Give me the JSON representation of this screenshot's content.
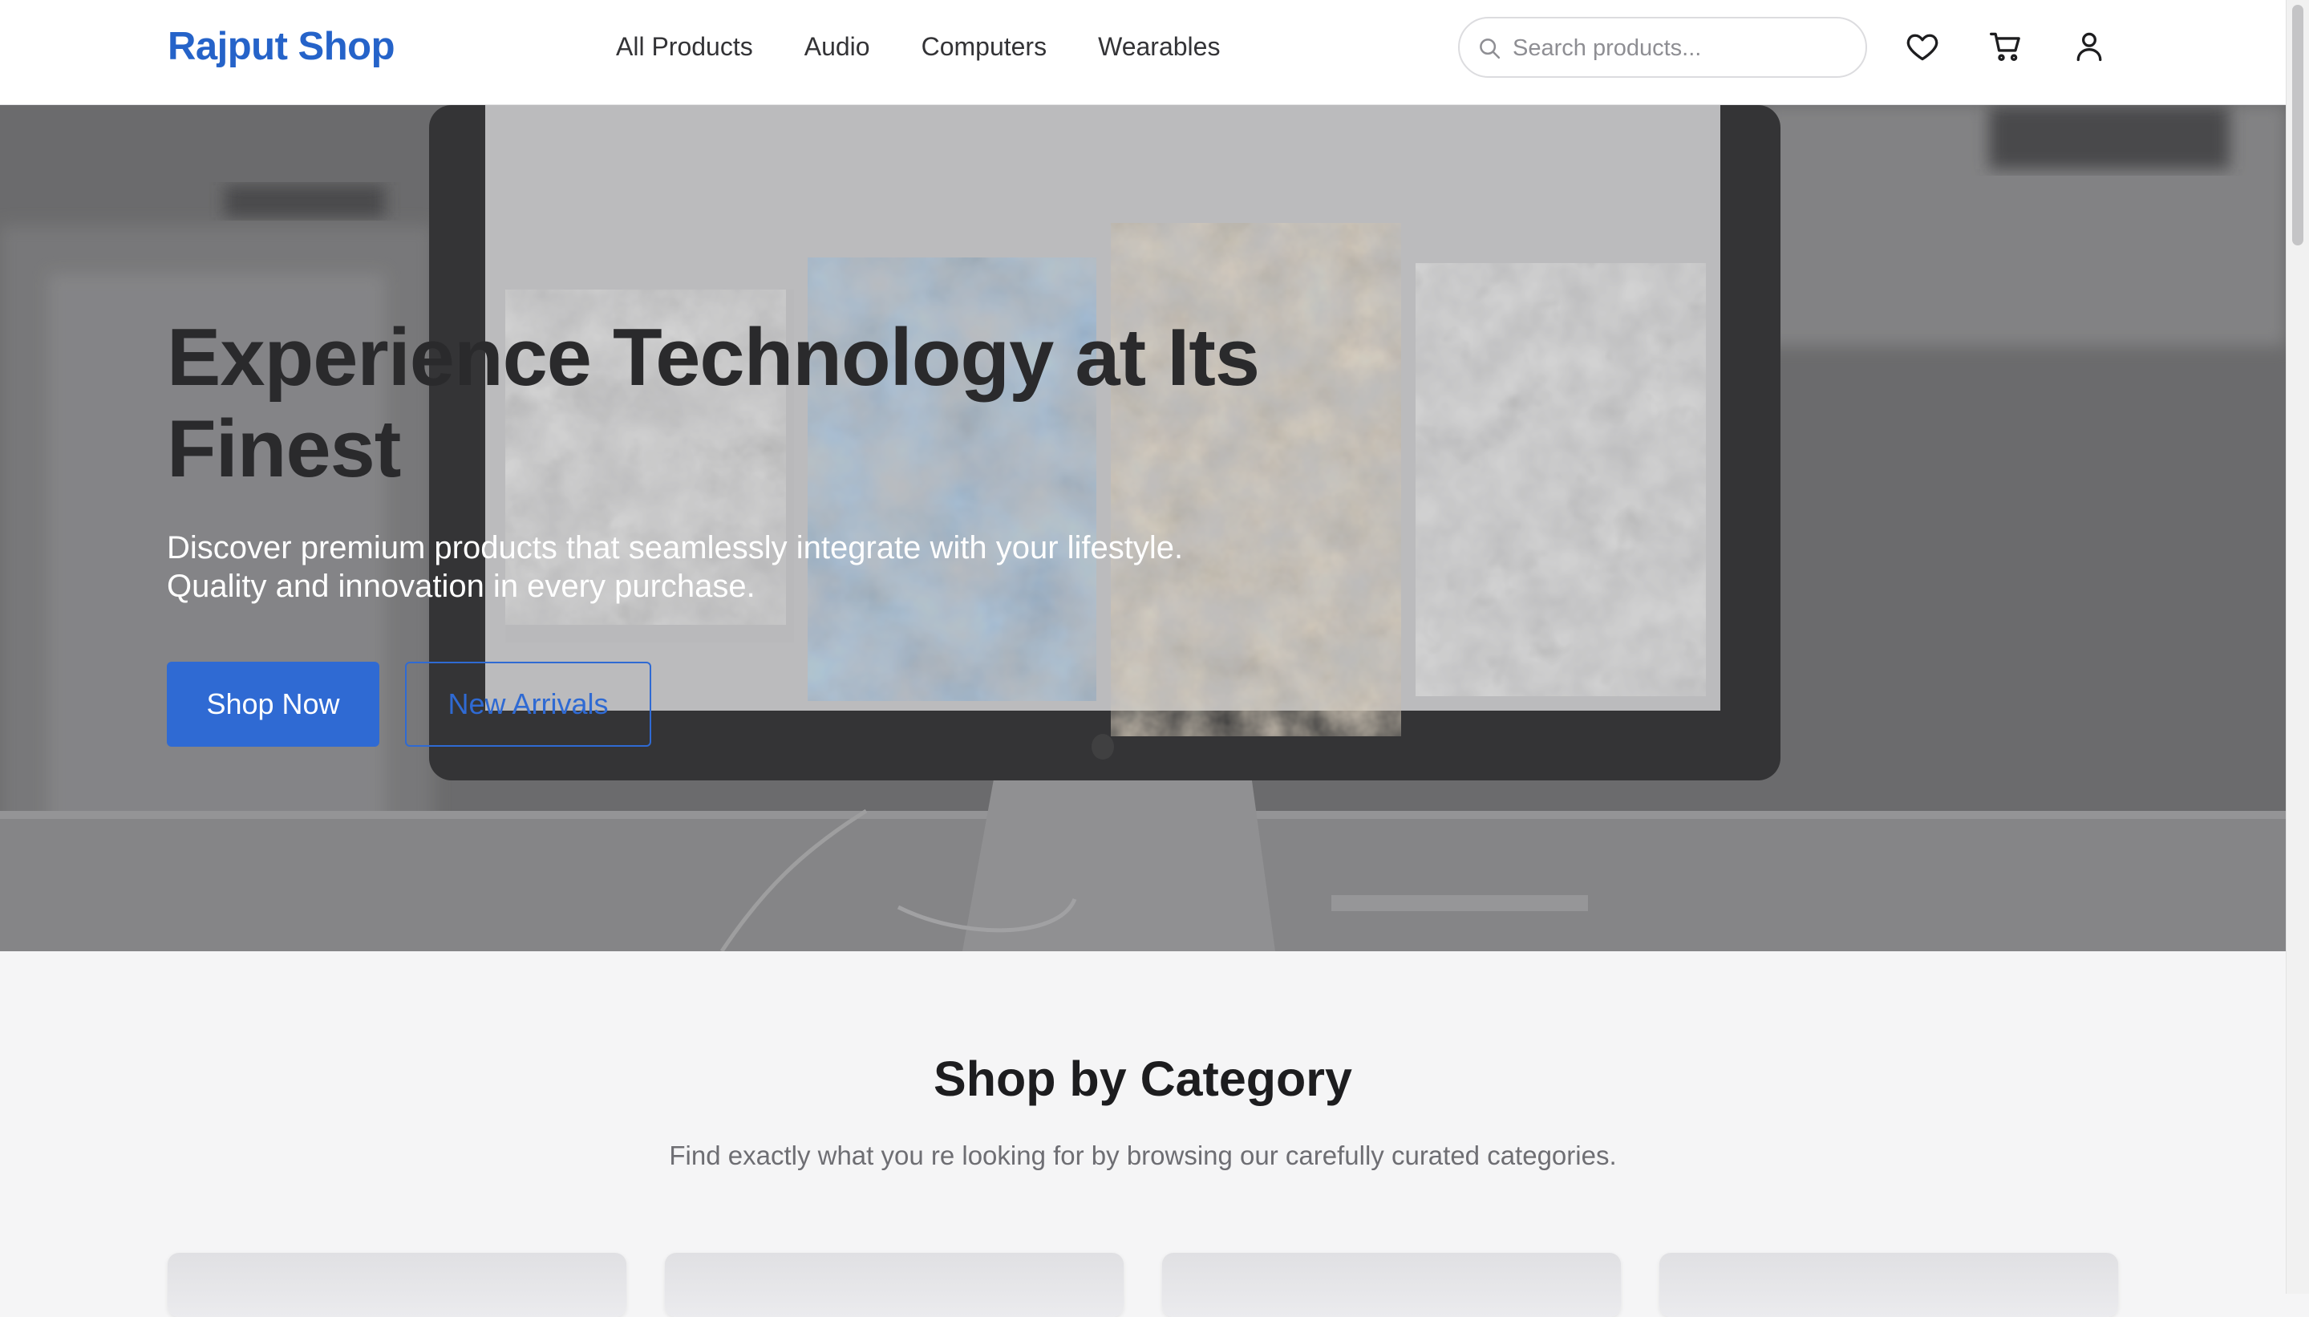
{
  "header": {
    "logo": "Rajput Shop",
    "nav": [
      "All Products",
      "Audio",
      "Computers",
      "Wearables"
    ],
    "search_placeholder": "Search products...",
    "icons": [
      "heart-icon",
      "cart-icon",
      "user-icon"
    ]
  },
  "hero": {
    "title": "Experience Technology at Its Finest",
    "subtitle_line1": "Discover premium products that seamlessly integrate with your lifestyle.",
    "subtitle_line2": "Quality and innovation in every purchase.",
    "primary_button": "Shop Now",
    "secondary_button": "New Arrivals"
  },
  "categories": {
    "title": "Shop by Category",
    "subtitle": "Find exactly what you re looking for by browsing our carefully curated categories."
  },
  "colors": {
    "accent": "#2f6ad3",
    "logo": "#2563c9",
    "background": "#f5f5f6"
  }
}
